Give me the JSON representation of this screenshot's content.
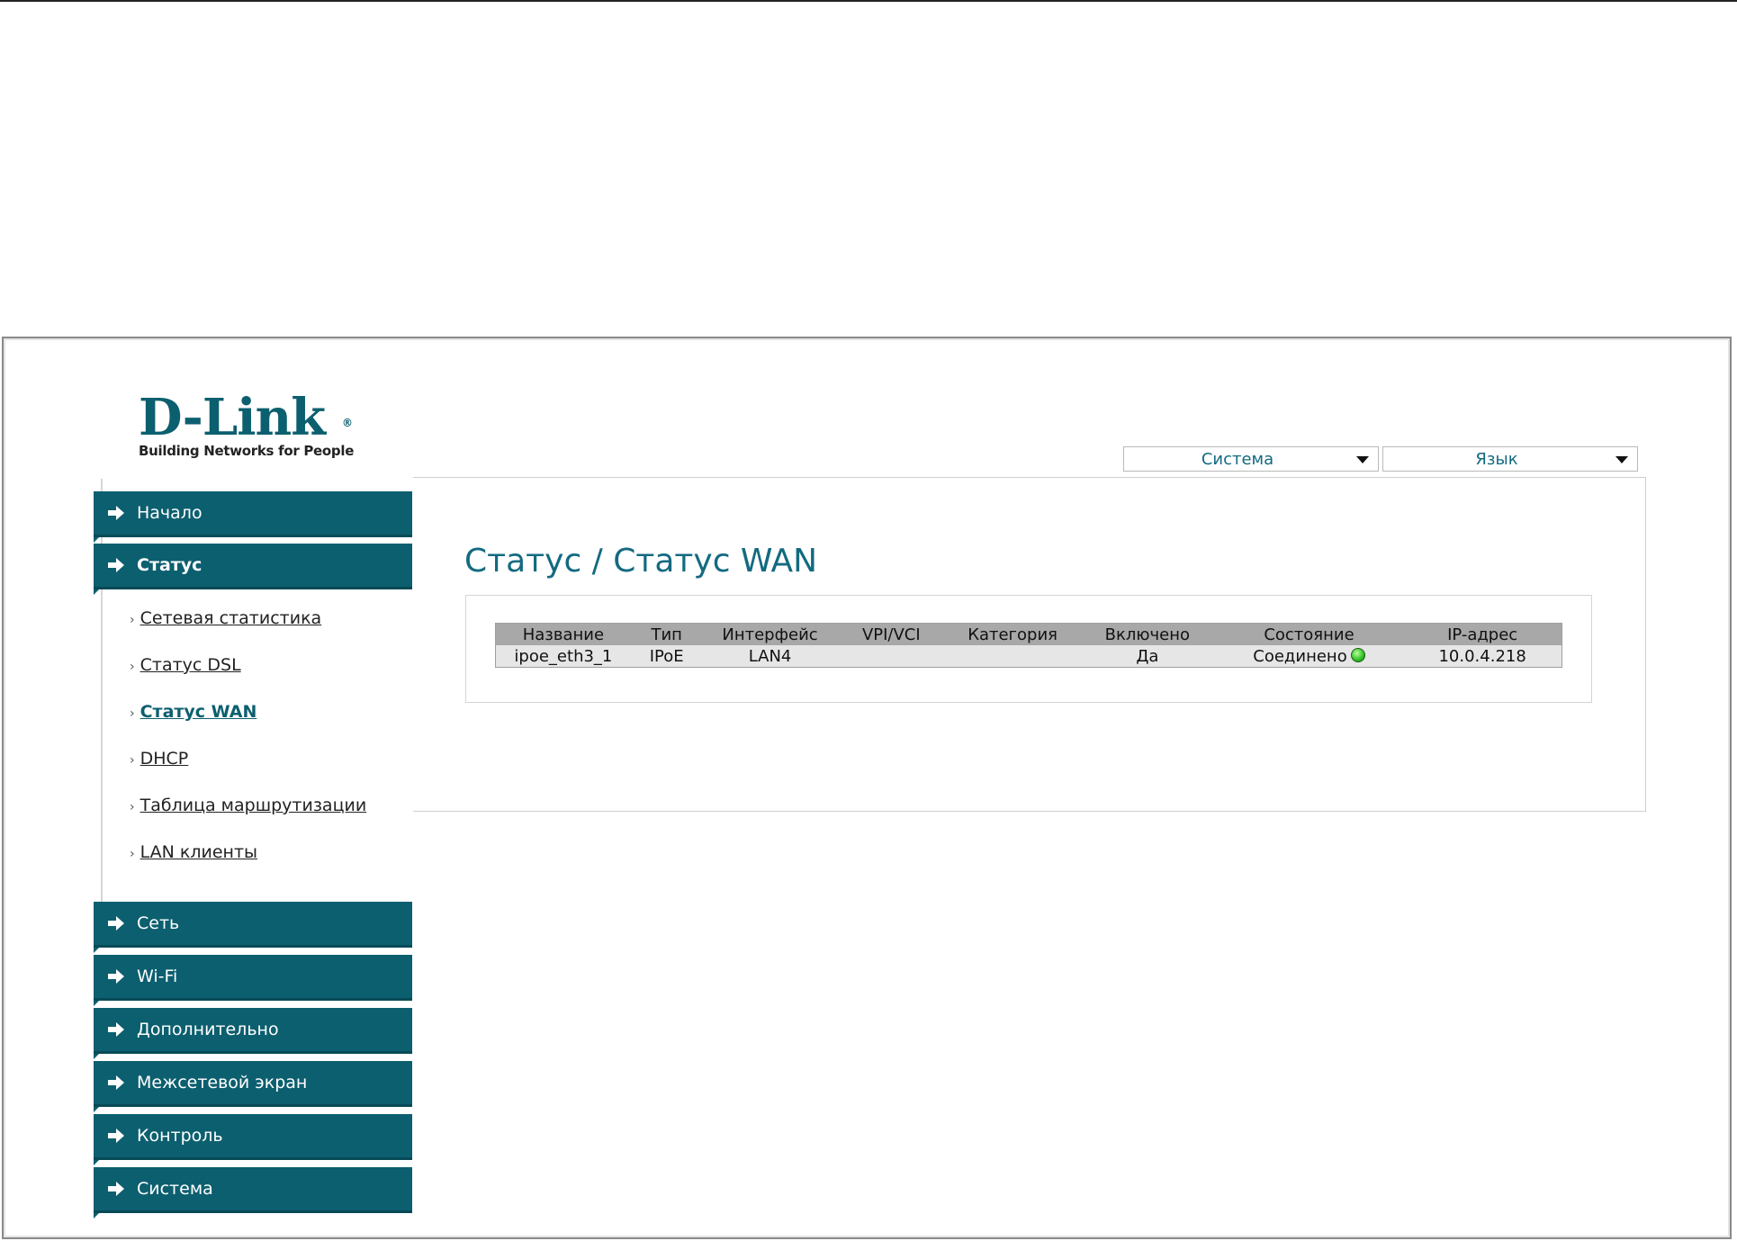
{
  "brand": {
    "logo_text": "D-Link",
    "registered_mark": "®",
    "tagline": "Building Networks for People"
  },
  "top_menu": {
    "system_label": "Система",
    "language_label": "Язык"
  },
  "sidebar": {
    "items": [
      {
        "label": "Начало"
      },
      {
        "label": "Статус",
        "active": true
      },
      {
        "label": "Сеть"
      },
      {
        "label": "Wi-Fi"
      },
      {
        "label": "Дополнительно"
      },
      {
        "label": "Межсетевой экран"
      },
      {
        "label": "Контроль"
      },
      {
        "label": "Система"
      }
    ],
    "submenu": [
      {
        "label": "Сетевая статистика"
      },
      {
        "label": "Статус DSL"
      },
      {
        "label": "Статус WAN",
        "active": true
      },
      {
        "label": "DHCP"
      },
      {
        "label": "Таблица маршрутизации"
      },
      {
        "label": "LAN клиенты"
      }
    ]
  },
  "main": {
    "title": "Статус / Статус WAN",
    "table": {
      "headers": [
        "Название",
        "Тип",
        "Интерфейс",
        "VPI/VCI",
        "Категория",
        "Включено",
        "Состояние",
        "IP-адрес"
      ],
      "rows": [
        [
          "ipoe_eth3_1",
          "IPoE",
          "LAN4",
          "",
          "",
          "Да",
          "Соединено",
          "10.0.4.218"
        ]
      ]
    }
  },
  "colors": {
    "brand_teal": "#0c5f6f",
    "title_teal": "#136a80",
    "status_connected": "#2fbf24"
  },
  "icons": {
    "nav_arrow": "arrow-right-icon",
    "dropdown": "chevron-down-icon",
    "status": "connected-status-icon"
  }
}
